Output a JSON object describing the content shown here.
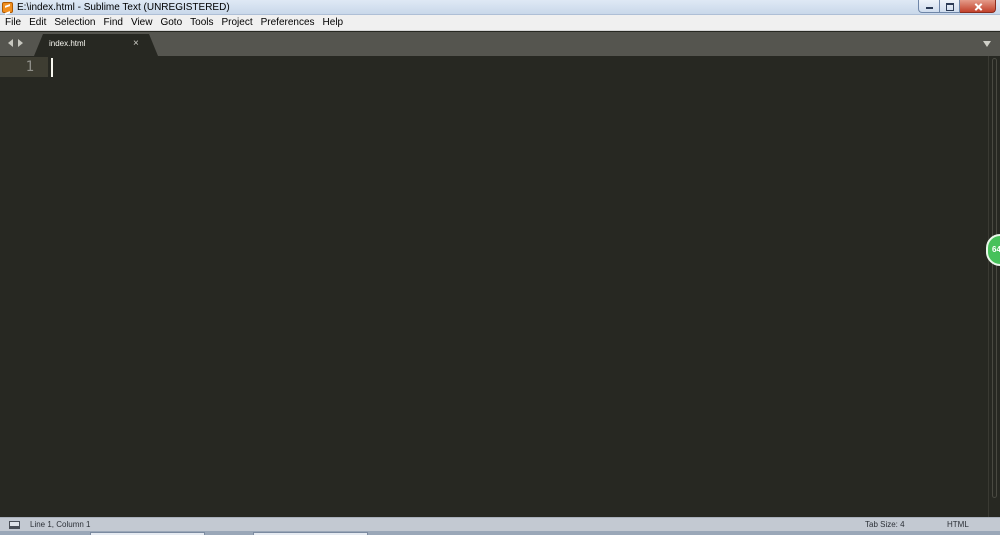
{
  "window": {
    "title": "E:\\index.html - Sublime Text (UNREGISTERED)"
  },
  "menu": {
    "items": [
      "File",
      "Edit",
      "Selection",
      "Find",
      "View",
      "Goto",
      "Tools",
      "Project",
      "Preferences",
      "Help"
    ]
  },
  "tabs": [
    {
      "label": "index.html",
      "close": "×",
      "active": true
    }
  ],
  "editor": {
    "line_numbers": [
      "1"
    ],
    "lines": [
      ""
    ]
  },
  "floating_badge": {
    "text": "64"
  },
  "status": {
    "position": "Line 1, Column 1",
    "tab_size": "Tab Size: 4",
    "syntax": "HTML"
  },
  "icons": {
    "app": "sublime-text-icon",
    "panel": "panel-toggle-icon",
    "tab_dropdown": "chevron-down-icon"
  },
  "colors": {
    "editor_bg": "#272822",
    "gutter_highlight": "#3e3d32",
    "tabbar_bg": "#55554f",
    "statusbar_bg": "#c3c9d2",
    "badge": "#46c15a"
  }
}
